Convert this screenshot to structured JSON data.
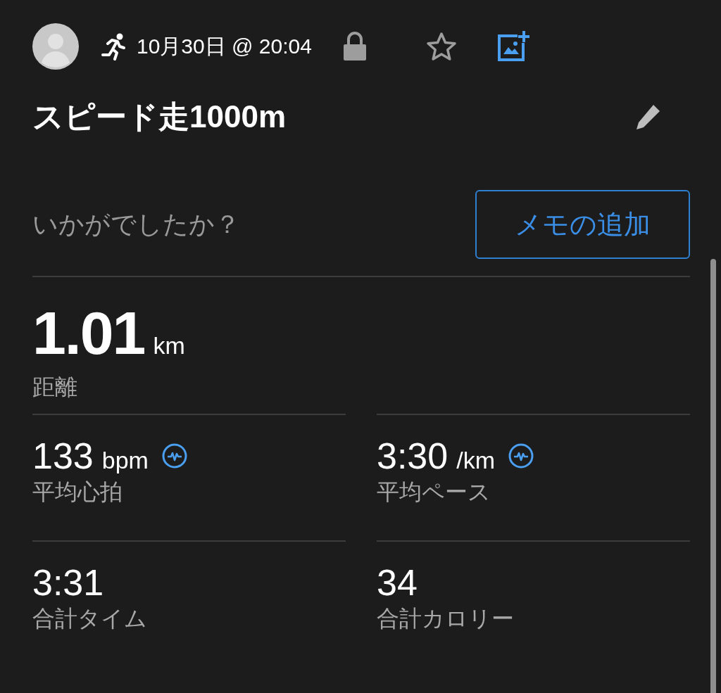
{
  "header": {
    "datetime": "10月30日 @ 20:04",
    "favorite": false
  },
  "title": "スピード走1000m",
  "note_prompt": {
    "question": "いかがでしたか？",
    "button": "メモの追加"
  },
  "main_stat": {
    "value": "1.01",
    "unit": "km",
    "label": "距離"
  },
  "stats": [
    {
      "value": "133",
      "unit": "bpm",
      "label": "平均心拍",
      "chart_link": true
    },
    {
      "value": "3:30",
      "unit": "/km",
      "label": "平均ペース",
      "chart_link": true
    },
    {
      "value": "3:31",
      "label": "合計タイム",
      "chart_link": false
    },
    {
      "value": "34",
      "label": "合計カロリー",
      "chart_link": false
    }
  ]
}
